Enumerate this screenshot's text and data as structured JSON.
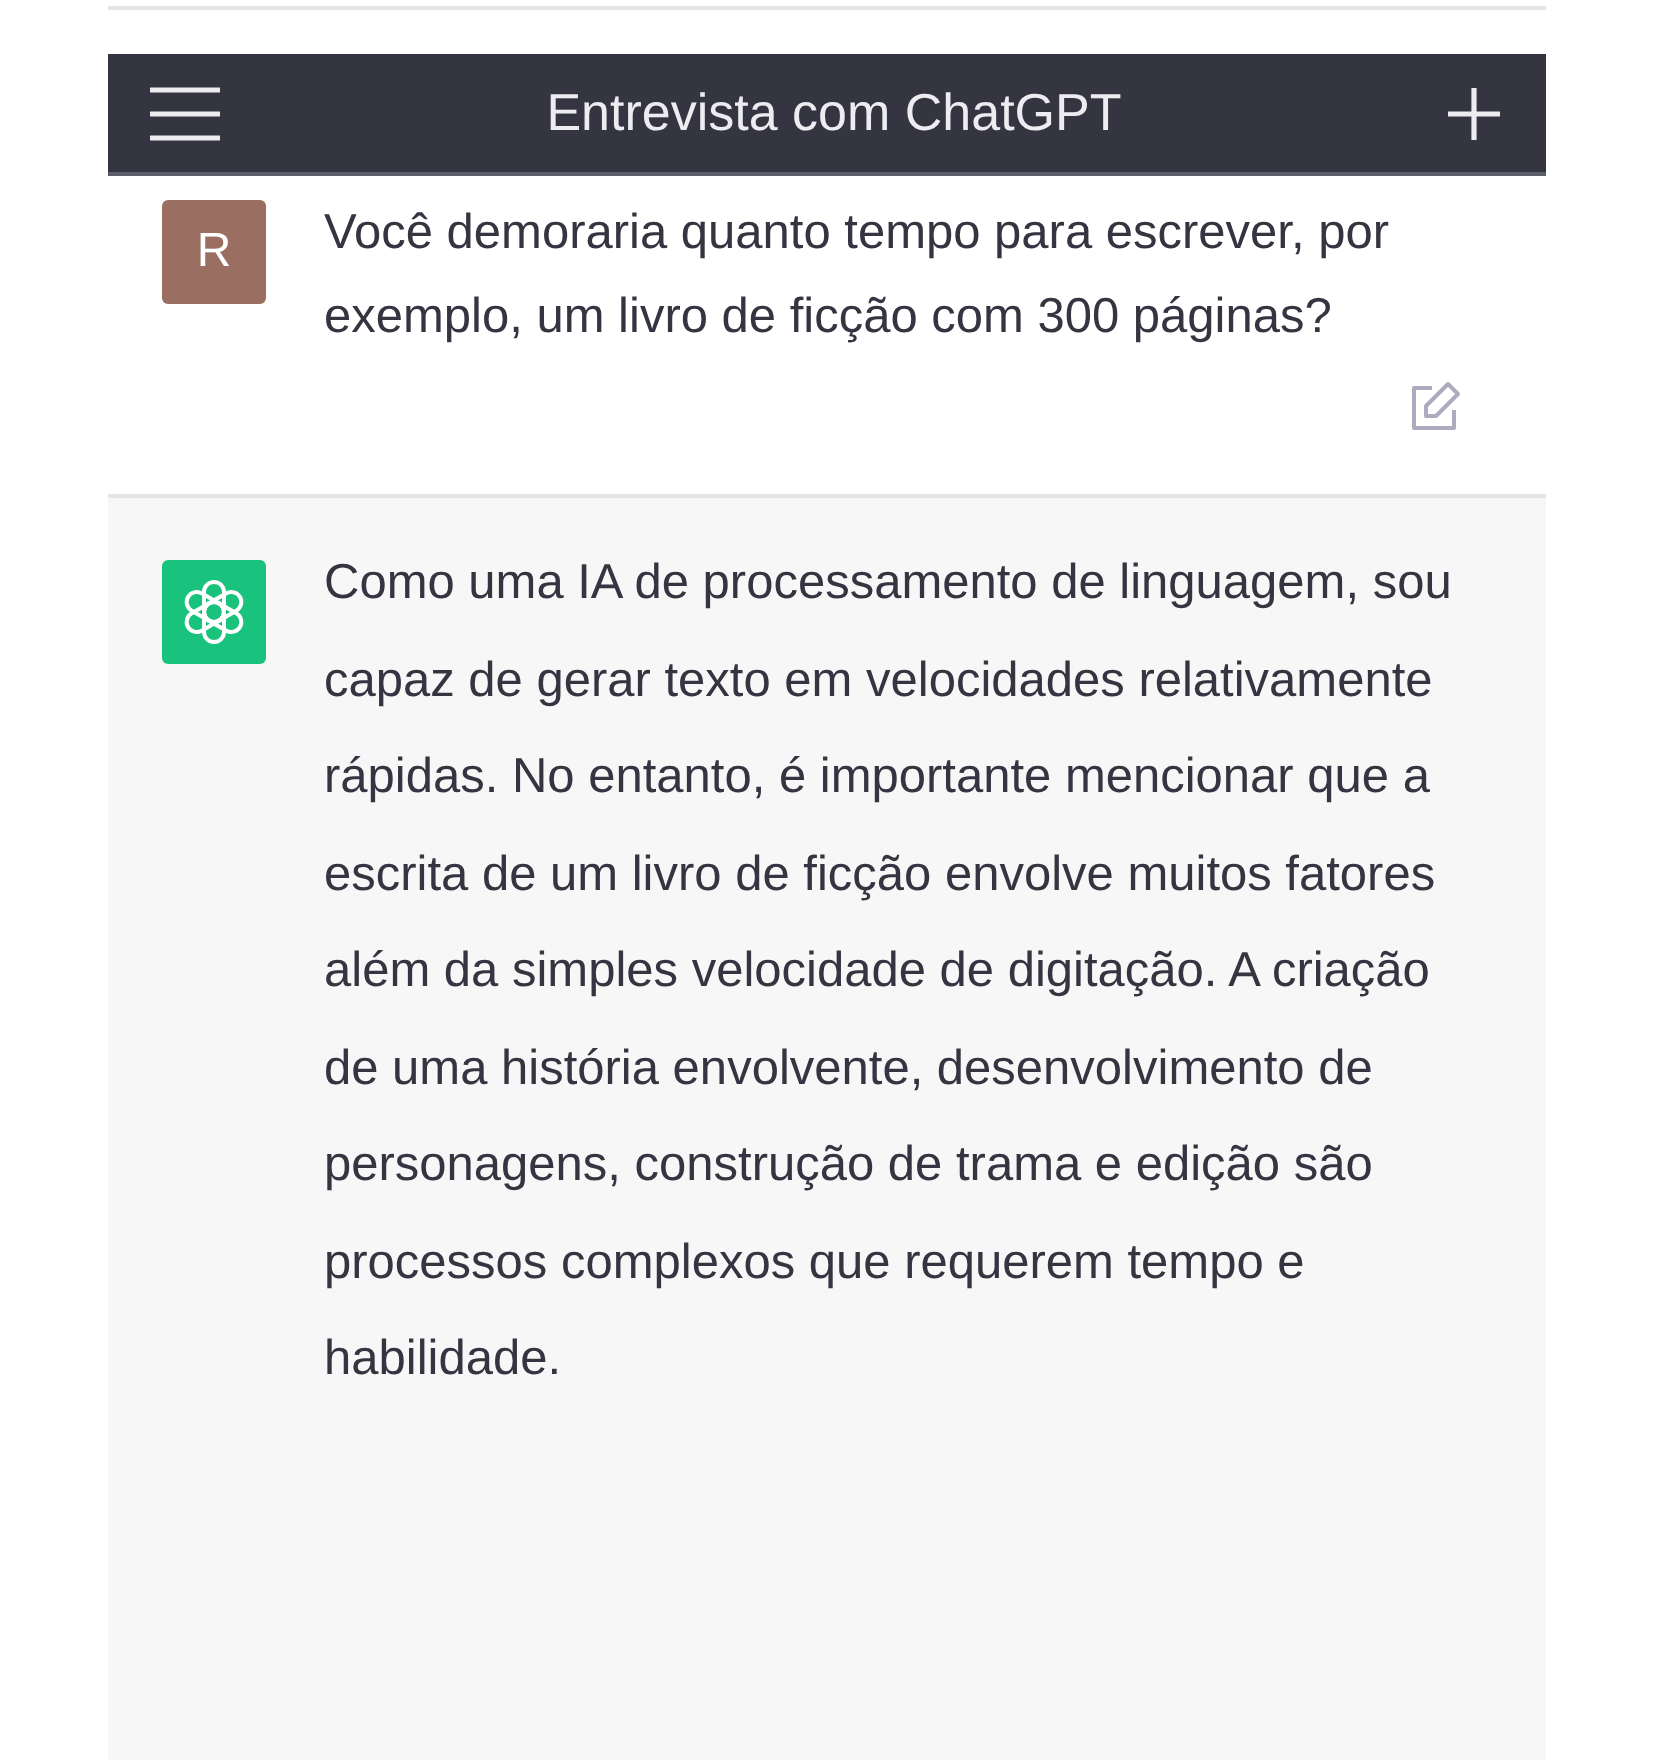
{
  "header": {
    "title": "Entrevista com ChatGPT"
  },
  "messages": [
    {
      "kind": "user",
      "avatar": "R",
      "text": "Você demoraria quanto tempo para escrever, por exemplo, um livro de ficção com 300 páginas?"
    },
    {
      "kind": "assistant",
      "text": "Como uma IA de processamento de linguagem, sou capaz de gerar texto em velocidades relativamente rápidas. No entanto, é importante mencionar que a escrita de um livro de ficção envolve muitos fatores além da simples velocidade de digitação. A criação de uma história envolvente, desenvolvimento de personagens, construção de trama e edição são processos complexos que requerem tempo e habilidade."
    }
  ]
}
